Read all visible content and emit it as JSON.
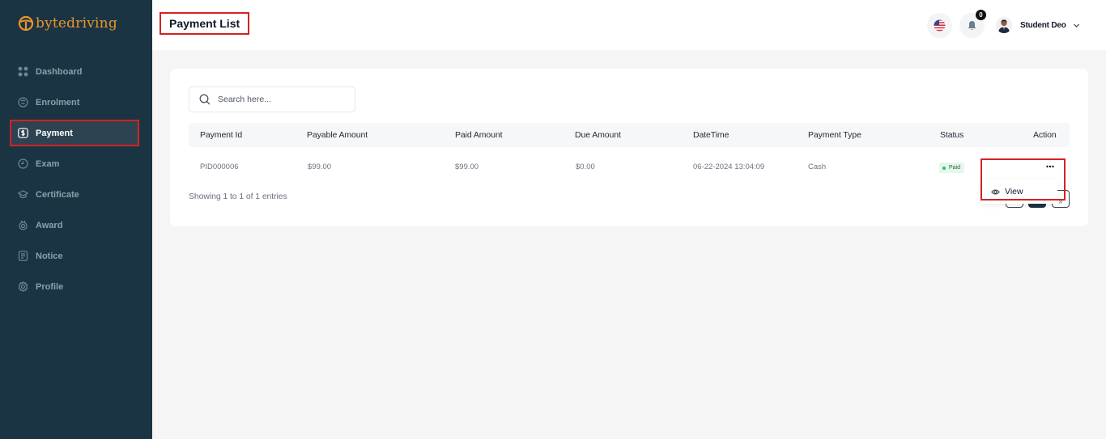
{
  "brand": {
    "logo_text": "bytedriving",
    "accent": "#e8952b"
  },
  "sidebar": {
    "items": [
      {
        "label": "Dashboard",
        "icon": "grid-icon",
        "active": false
      },
      {
        "label": "Enrolment",
        "icon": "enrolment-icon",
        "active": false
      },
      {
        "label": "Payment",
        "icon": "dollar-icon",
        "active": true
      },
      {
        "label": "Exam",
        "icon": "clock-icon",
        "active": false
      },
      {
        "label": "Certificate",
        "icon": "graduation-cap-icon",
        "active": false
      },
      {
        "label": "Award",
        "icon": "award-icon",
        "active": false
      },
      {
        "label": "Notice",
        "icon": "notice-icon",
        "active": false
      },
      {
        "label": "Profile",
        "icon": "gear-icon",
        "active": false
      }
    ]
  },
  "header": {
    "title": "Payment List",
    "notification_count": "0",
    "user_name": "Student Deo"
  },
  "search": {
    "placeholder": "Search here..."
  },
  "table": {
    "columns": [
      "Payment Id",
      "Payable Amount",
      "Paid Amount",
      "Due Amount",
      "DateTime",
      "Payment Type",
      "Status",
      "Action"
    ],
    "rows": [
      {
        "payment_id": "PID000006",
        "payable": "$99.00",
        "paid": "$99.00",
        "due": "$0.00",
        "datetime": "06-22-2024 13:04:09",
        "type": "Cash",
        "status": "Paid"
      }
    ]
  },
  "footer": {
    "entries_text": "Showing 1 to 1 of 1 entries",
    "last_glyph": "»"
  },
  "action_menu": {
    "items": [
      {
        "label": "View",
        "icon": "eye-icon"
      }
    ]
  },
  "colors": {
    "sidebar_bg": "#1b3443",
    "highlight": "#d42222",
    "status_paid": "#22c55e"
  }
}
